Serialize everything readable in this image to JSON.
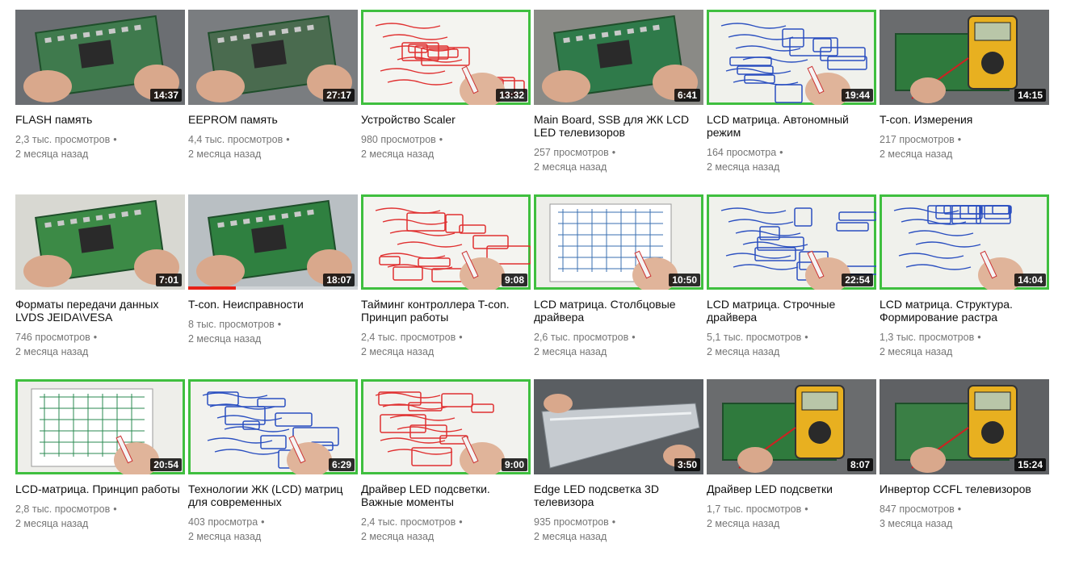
{
  "videos": [
    {
      "title": "FLASH память",
      "views": "2,3 тыс. просмотров",
      "age": "2 месяца назад",
      "duration": "14:37",
      "kind": "board",
      "color": "#3f7a4d",
      "bg": "#6b6e72"
    },
    {
      "title": "EEPROM память",
      "views": "4,4 тыс. просмотров",
      "age": "2 месяца назад",
      "duration": "27:17",
      "kind": "board",
      "color": "#4a6b4f",
      "bg": "#7a7d80"
    },
    {
      "title": "Устройство Scaler",
      "views": "980 просмотров",
      "age": "2 месяца назад",
      "duration": "13:32",
      "kind": "whiteboard",
      "color": "#e03030",
      "bg": "#f4f4f0"
    },
    {
      "title": "Main Board, SSB для ЖК LCD LED телевизоров",
      "views": "257 просмотров",
      "age": "2 месяца назад",
      "duration": "6:41",
      "kind": "board",
      "color": "#2f7a4a",
      "bg": "#8a8a86"
    },
    {
      "title": "LCD матрица. Автономный режим",
      "views": "164 просмотра",
      "age": "2 месяца назад",
      "duration": "19:44",
      "kind": "whiteboard",
      "color": "#2a4fc0",
      "bg": "#f0f1ec"
    },
    {
      "title": "T-con. Измерения",
      "views": "217 просмотров",
      "age": "2 месяца назад",
      "duration": "14:15",
      "kind": "meter",
      "color": "#2f7a3d",
      "bg": "#6a6c6e"
    },
    {
      "title": "Форматы передачи данных LVDS JEIDA\\VESA",
      "views": "746 просмотров",
      "age": "2 месяца назад",
      "duration": "7:01",
      "kind": "board",
      "color": "#3c8a46",
      "bg": "#d8d8d2"
    },
    {
      "title": "T-con. Неисправности",
      "views": "8 тыс. просмотров",
      "age": "2 месяца назад",
      "duration": "18:07",
      "kind": "board",
      "color": "#2f8040",
      "bg": "#b9bfc3",
      "progress": 0.28
    },
    {
      "title": "Тайминг контроллера T-con. Принцип работы",
      "views": "2,4 тыс. просмотров",
      "age": "2 месяца назад",
      "duration": "9:08",
      "kind": "whiteboard",
      "color": "#e03030",
      "bg": "#f4f4f0"
    },
    {
      "title": "LCD матрица. Столбцовые драйвера",
      "views": "2,6 тыс. просмотров",
      "age": "2 месяца назад",
      "duration": "10:50",
      "kind": "diagram",
      "color": "#3a6fb0",
      "bg": "#eeeeea"
    },
    {
      "title": "LCD матрица. Строчные драйвера",
      "views": "5,1 тыс. просмотров",
      "age": "2 месяца назад",
      "duration": "22:54",
      "kind": "whiteboard",
      "color": "#2a4fc0",
      "bg": "#f0f1ec"
    },
    {
      "title": "LCD матрица. Структура. Формирование растра",
      "views": "1,3 тыс. просмотров",
      "age": "2 месяца назад",
      "duration": "14:04",
      "kind": "whiteboard",
      "color": "#2a4fc0",
      "bg": "#f0f1ec"
    },
    {
      "title": "LCD-матрица. Принцип работы",
      "views": "2,8 тыс. просмотров",
      "age": "2 месяца назад",
      "duration": "20:54",
      "kind": "diagram",
      "color": "#2a8a50",
      "bg": "#eeeeea"
    },
    {
      "title": "Технологии ЖК (LCD) матриц для современных",
      "views": "403 просмотра",
      "age": "2 месяца назад",
      "duration": "6:29",
      "kind": "whiteboard",
      "color": "#2a4fc0",
      "bg": "#f2f2ee"
    },
    {
      "title": "Драйвер LED подсветки. Важные моменты",
      "views": "2,4 тыс. просмотров",
      "age": "2 месяца назад",
      "duration": "9:00",
      "kind": "whiteboard",
      "color": "#e03030",
      "bg": "#f2f2ee"
    },
    {
      "title": "Edge LED подсветка 3D телевизора",
      "views": "935 просмотров",
      "age": "2 месяца назад",
      "duration": "3:50",
      "kind": "strip",
      "color": "#9aa0a6",
      "bg": "#5a5e62"
    },
    {
      "title": "Драйвер LED подсветки",
      "views": "1,7 тыс. просмотров",
      "age": "2 месяца назад",
      "duration": "8:07",
      "kind": "meter",
      "color": "#2f7a3d",
      "bg": "#6a6c6e"
    },
    {
      "title": "Инвертор CCFL телевизоров",
      "views": "847 просмотров",
      "age": "3 месяца назад",
      "duration": "15:24",
      "kind": "meter",
      "color": "#3a7f45",
      "bg": "#5f6164"
    }
  ]
}
